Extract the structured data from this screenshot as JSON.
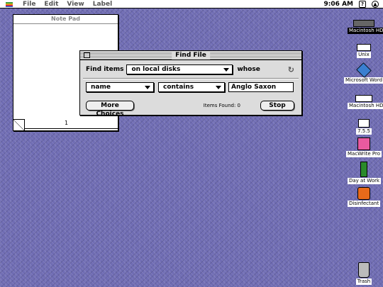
{
  "menubar": {
    "apple_icon": "apple-rainbow-icon",
    "items": [
      "File",
      "Edit",
      "View",
      "Label"
    ],
    "time": "9:06 AM",
    "help_icon": "balloon-help-icon",
    "app_icon": "application-menu-icon"
  },
  "notepad": {
    "title": "Note Pad",
    "page_number": "1"
  },
  "findfile": {
    "title": "Find File",
    "find_items_label": "Find items",
    "location_value": "on local disks",
    "whose_label": "whose",
    "criteria_value": "name",
    "operator_value": "contains",
    "search_value": "Anglo Saxon",
    "more_choices_label": "More Choices",
    "items_found_label": "Items Found: 0",
    "stop_label": "Stop"
  },
  "desktop_icons": [
    {
      "label": "Macintosh HD",
      "icon": "hard-drive-icon"
    },
    {
      "label": "Unix",
      "icon": "disk-icon"
    },
    {
      "label": "Microsoft Word",
      "icon": "microsoft-word-icon"
    },
    {
      "label": "Macintosh HD",
      "icon": "hard-drive-icon"
    },
    {
      "label": "7.5.5",
      "icon": "floppy-icon"
    },
    {
      "label": "MacWrite Pro",
      "icon": "macwrite-pro-icon"
    },
    {
      "label": "Day at Work",
      "icon": "day-at-work-icon"
    },
    {
      "label": "Disinfectant",
      "icon": "disinfectant-icon"
    },
    {
      "label": "Trash",
      "icon": "trash-icon"
    }
  ],
  "colors": {
    "desktop": "#6f6cb3",
    "window_bg": "#dcdcdc"
  }
}
